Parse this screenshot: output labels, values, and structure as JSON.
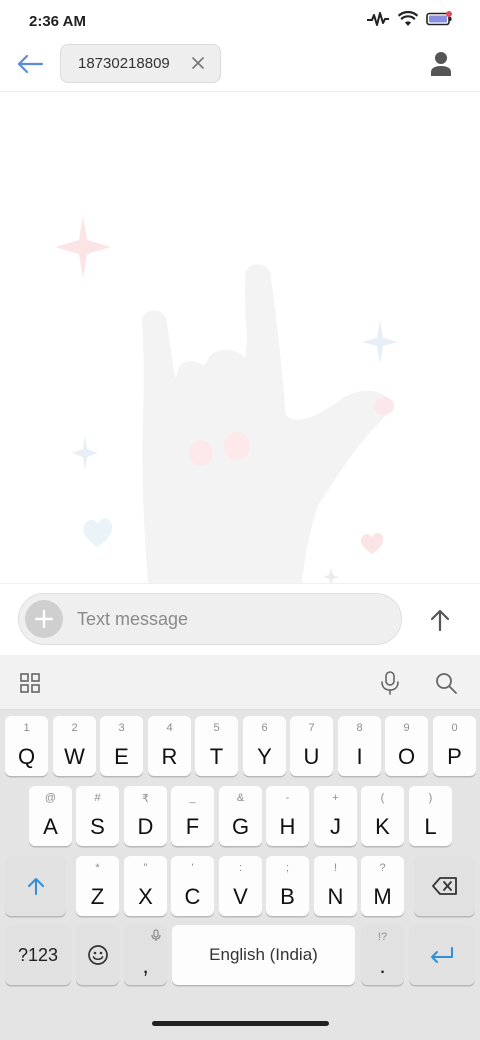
{
  "status_bar": {
    "time": "2:36 AM",
    "icons": [
      "activity-icon",
      "wifi-icon",
      "battery-icon"
    ]
  },
  "header": {
    "back_icon": "arrow-left-icon",
    "recipient": "18730218809",
    "chip_close_icon": "close-icon",
    "contact_icon": "person-icon",
    "accent_color": "#5b8bd9"
  },
  "compose": {
    "placeholder": "Text message",
    "add_icon": "plus-icon",
    "send_icon": "arrow-up-icon"
  },
  "keyboard": {
    "toolbar": {
      "left_icon": "grid-icon",
      "right_icons": [
        "microphone-icon",
        "search-icon"
      ]
    },
    "row1": [
      {
        "hint": "1",
        "label": "Q"
      },
      {
        "hint": "2",
        "label": "W"
      },
      {
        "hint": "3",
        "label": "E"
      },
      {
        "hint": "4",
        "label": "R"
      },
      {
        "hint": "5",
        "label": "T"
      },
      {
        "hint": "6",
        "label": "Y"
      },
      {
        "hint": "7",
        "label": "U"
      },
      {
        "hint": "8",
        "label": "I"
      },
      {
        "hint": "9",
        "label": "O"
      },
      {
        "hint": "0",
        "label": "P"
      }
    ],
    "row2": [
      {
        "hint": "@",
        "label": "A"
      },
      {
        "hint": "#",
        "label": "S"
      },
      {
        "hint": "₹",
        "label": "D"
      },
      {
        "hint": "_",
        "label": "F"
      },
      {
        "hint": "&",
        "label": "G"
      },
      {
        "hint": "-",
        "label": "H"
      },
      {
        "hint": "+",
        "label": "J"
      },
      {
        "hint": "(",
        "label": "K"
      },
      {
        "hint": ")",
        "label": "L"
      }
    ],
    "row3": [
      {
        "hint": "*",
        "label": "Z"
      },
      {
        "hint": "\"",
        "label": "X"
      },
      {
        "hint": "'",
        "label": "C"
      },
      {
        "hint": ":",
        "label": "V"
      },
      {
        "hint": ";",
        "label": "B"
      },
      {
        "hint": "!",
        "label": "N"
      },
      {
        "hint": "?",
        "label": "M"
      }
    ],
    "row4": {
      "symbols": "?123",
      "emoji_icon": "emoji-icon",
      "comma": ",",
      "comma_hint_icon": "microphone-icon",
      "space": "English (India)",
      "period_hint": "!?",
      "period": ".",
      "enter_icon": "enter-icon"
    },
    "shift_icon": "shift-icon",
    "backspace_icon": "backspace-icon",
    "accent_color": "#2f8fd8"
  }
}
